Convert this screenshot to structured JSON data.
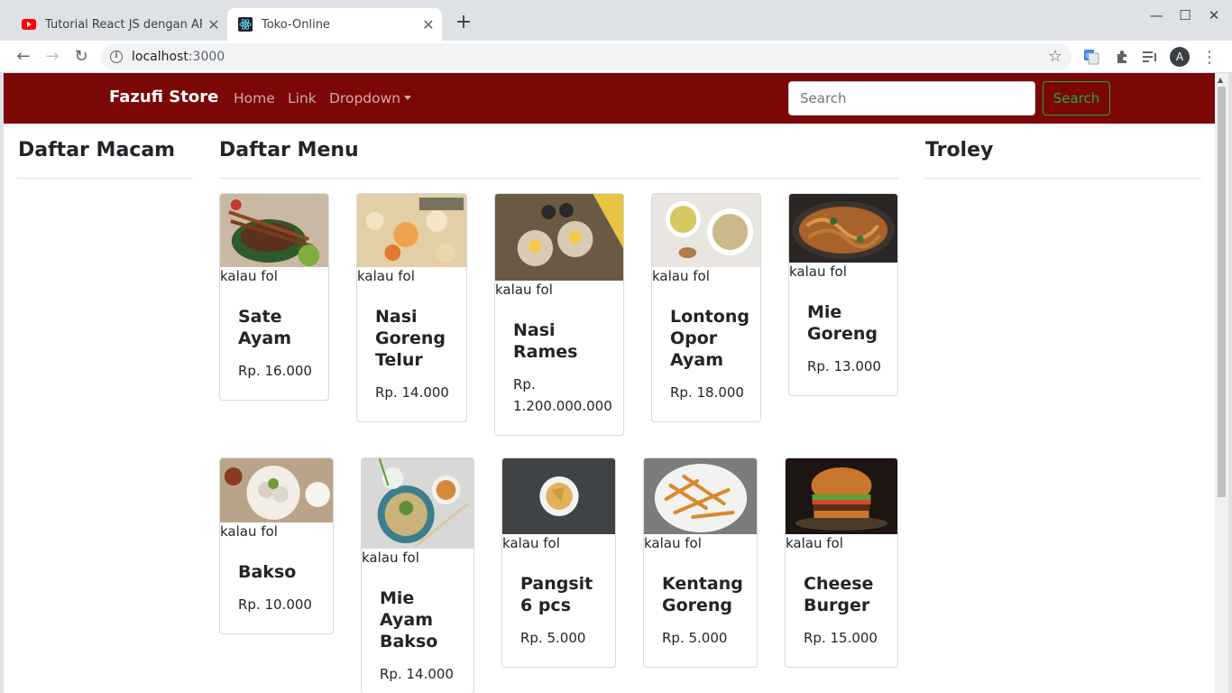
{
  "browser": {
    "tabs": [
      {
        "title": "Tutorial React JS dengan API"
      },
      {
        "title": "Toko-Online"
      }
    ],
    "url_host": "localhost",
    "url_port": ":3000"
  },
  "navbar": {
    "brand": "Fazufi Store",
    "links": [
      "Home",
      "Link",
      "Dropdown"
    ],
    "search_placeholder": "Search",
    "search_button": "Search"
  },
  "columns": {
    "left_title": "Daftar Macam",
    "middle_title": "Daftar Menu",
    "right_title": "Troley"
  },
  "menu": [
    {
      "caption": "kalau fol",
      "name": "Sate Ayam",
      "price": "Rp. 16.000"
    },
    {
      "caption": "kalau fol",
      "name": "Nasi Goreng Telur",
      "price": "Rp. 14.000"
    },
    {
      "caption": "kalau fol",
      "name": "Nasi Rames",
      "price": "Rp. 1.200.000.000"
    },
    {
      "caption": "kalau fol",
      "name": "Lontong Opor Ayam",
      "price": "Rp. 18.000"
    },
    {
      "caption": "kalau fol",
      "name": "Mie Goreng",
      "price": "Rp. 13.000"
    },
    {
      "caption": "kalau fol",
      "name": "Bakso",
      "price": "Rp. 10.000"
    },
    {
      "caption": "kalau fol",
      "name": "Mie Ayam Bakso",
      "price": "Rp. 14.000"
    },
    {
      "caption": "kalau fol",
      "name": "Pangsit 6 pcs",
      "price": "Rp. 5.000"
    },
    {
      "caption": "kalau fol",
      "name": "Kentang Goreng",
      "price": "Rp. 5.000"
    },
    {
      "caption": "kalau fol",
      "name": "Cheese Burger",
      "price": "Rp. 15.000"
    }
  ],
  "icons": {
    "tab1_favicon": "youtube-icon",
    "tab2_favicon": "react-icon",
    "navbar_caret": "caret-down-icon"
  }
}
